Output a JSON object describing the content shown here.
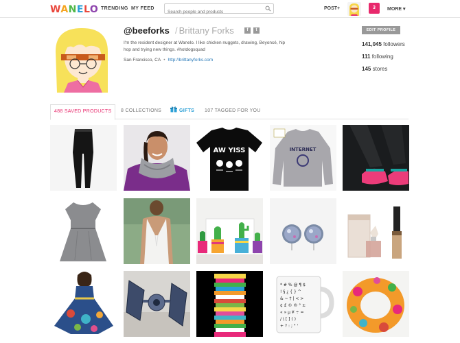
{
  "nav": {
    "logo": "WANELO",
    "links": [
      "TRENDING",
      "MY FEED"
    ],
    "search_placeholder": "Search people and products",
    "post_label": "POST+",
    "notification_count": "3",
    "more_label": "MORE ▾"
  },
  "profile": {
    "handle": "@beeforks",
    "name": "Brittany Forks",
    "social": [
      "f",
      "t"
    ],
    "bio": "I'm the resident designer at Wanelo. I like chicken nuggets, drawing, Beyoncé, hip hop and trying new things. #hotdogsquad",
    "location": "San Francisco, CA",
    "website": "http://brittanyforks.com",
    "edit_label": "EDIT PROFILE",
    "followers": {
      "count": "141,045",
      "label": "followers"
    },
    "following": {
      "count": "111",
      "label": "following"
    },
    "stores": {
      "count": "145",
      "label": "stores"
    }
  },
  "tabs": [
    {
      "label": "488 SAVED PRODUCTS",
      "active": true
    },
    {
      "label": "8 COLLECTIONS",
      "active": false
    },
    {
      "label": "GIFTS",
      "active": false
    },
    {
      "label": "107 TAGGED FOR YOU",
      "active": false
    }
  ],
  "products": [
    {
      "name": "black-leggings"
    },
    {
      "name": "gray-infinity-scarf"
    },
    {
      "name": "aw-yiss-tshirt",
      "text": "AW YISS"
    },
    {
      "name": "internet-sweatshirt",
      "text": "INTERNET"
    },
    {
      "name": "pink-flats"
    },
    {
      "name": "gray-dress"
    },
    {
      "name": "white-tank-top"
    },
    {
      "name": "cactus-planters"
    },
    {
      "name": "druzy-earrings"
    },
    {
      "name": "viktor-rolf-perfume"
    },
    {
      "name": "printed-party-dress"
    },
    {
      "name": "tie-fighter-model"
    },
    {
      "name": "stacked-bowls"
    },
    {
      "name": "symbols-mug"
    },
    {
      "name": "floral-scarf"
    }
  ]
}
